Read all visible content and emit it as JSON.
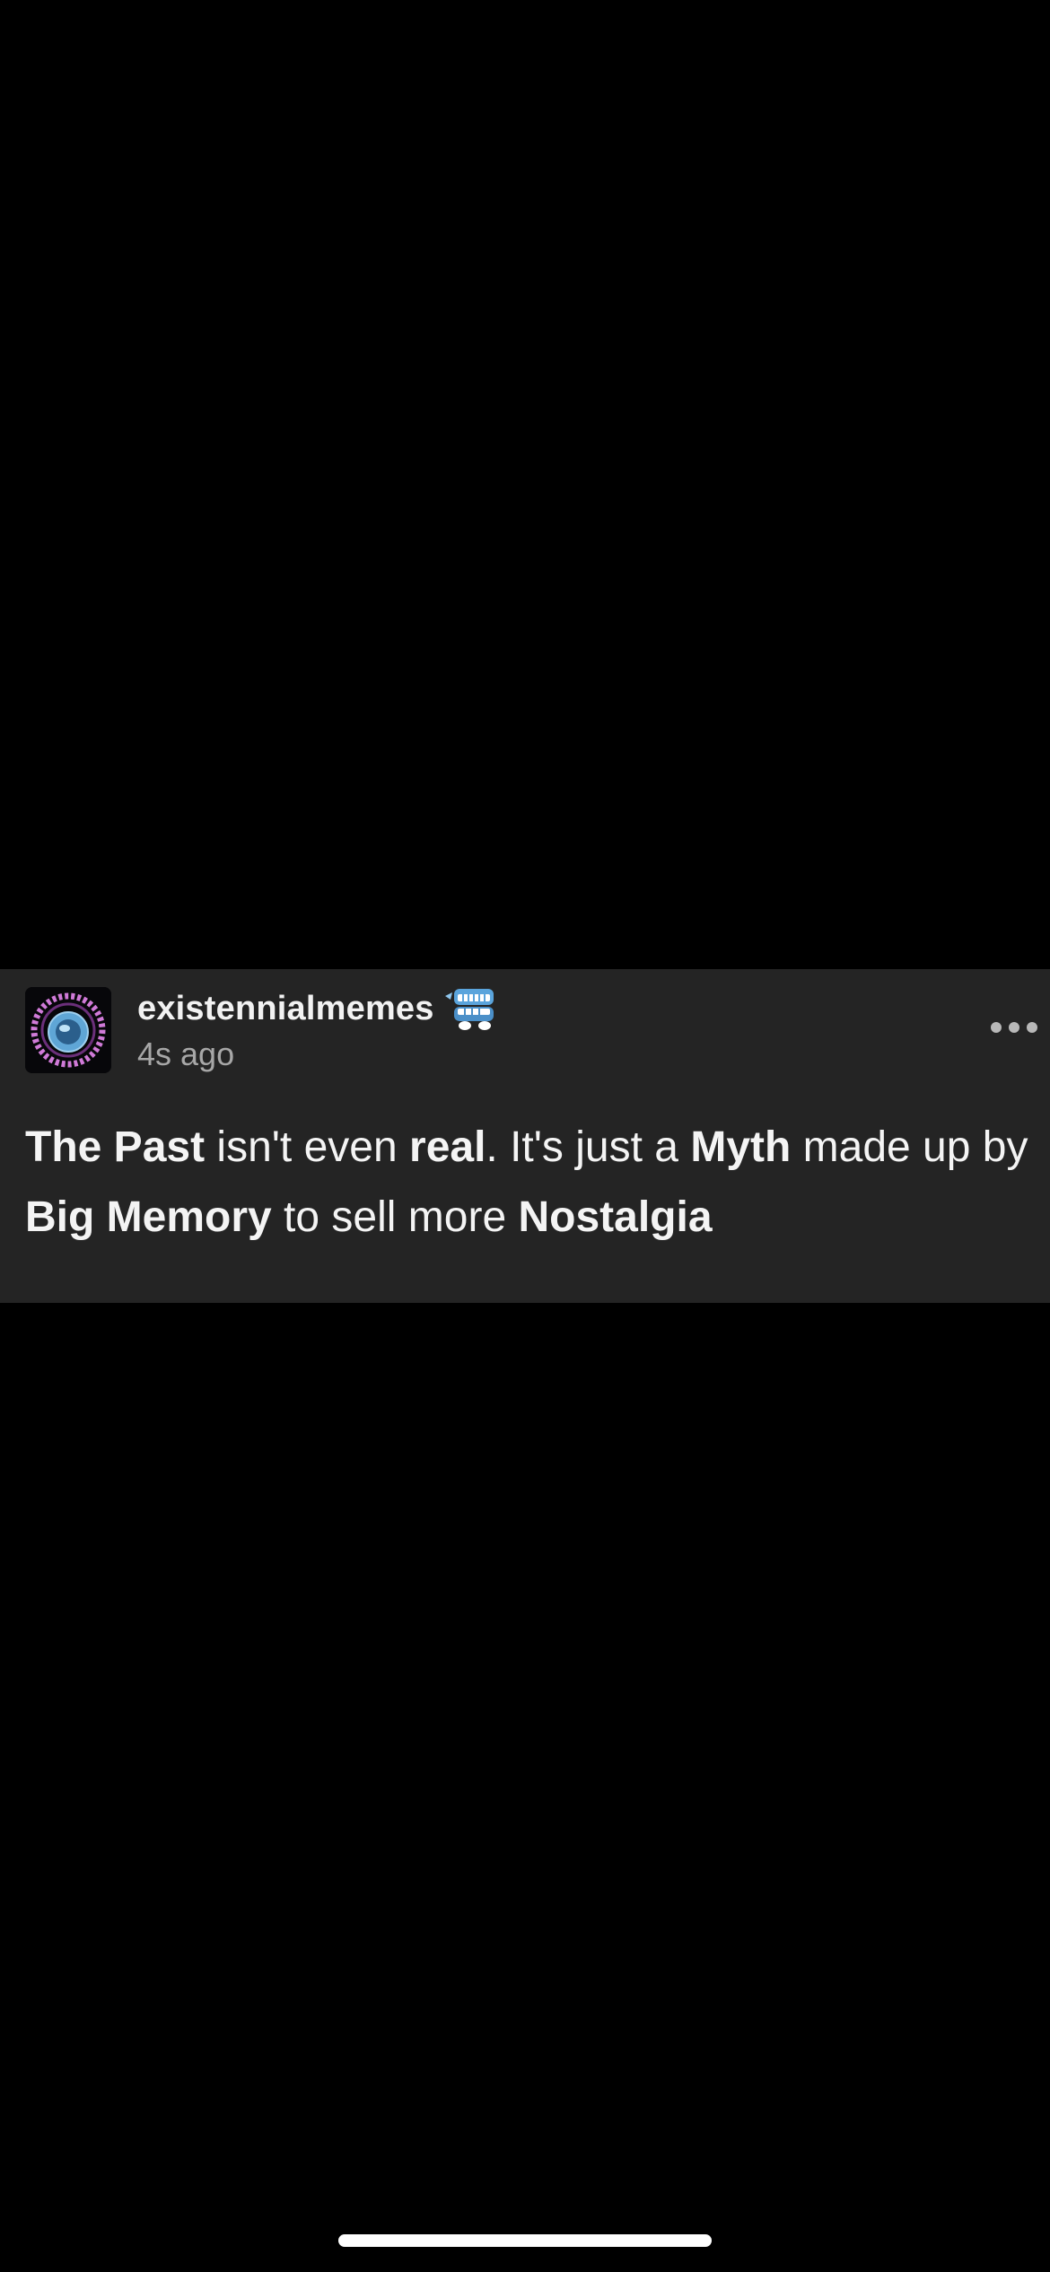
{
  "post": {
    "username": "existennialmemes",
    "timestamp": "4s ago",
    "avatar_icon": "existential-memes-logo-icon",
    "badge_icon": "chattering-teeth-badge-icon",
    "more_icon": "more-dots-icon",
    "body_segments": [
      {
        "text": "The Past",
        "bold": true
      },
      {
        "text": " isn't even ",
        "bold": false
      },
      {
        "text": "real",
        "bold": true
      },
      {
        "text": ". It's just a ",
        "bold": false
      },
      {
        "text": "Myth",
        "bold": true
      },
      {
        "text": " made up by ",
        "bold": false
      },
      {
        "text": "Big Memory",
        "bold": true
      },
      {
        "text": " to sell more ",
        "bold": false
      },
      {
        "text": "Nostalgia",
        "bold": true
      }
    ]
  },
  "colors": {
    "background": "#000000",
    "card": "#242424",
    "text_primary": "#f4f4f4",
    "text_secondary": "#a7a7a7"
  }
}
